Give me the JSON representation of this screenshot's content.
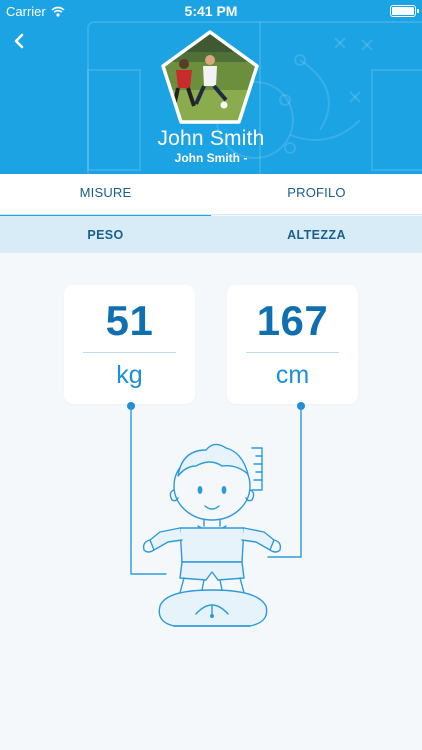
{
  "status_bar": {
    "carrier": "Carrier",
    "time": "5:41 PM",
    "icons": [
      "wifi-icon",
      "battery-icon"
    ]
  },
  "header": {
    "back_icon": "chevron-left-icon",
    "player_name": "John Smith",
    "player_subtitle": "John Smith -",
    "background_color": "#1ca3e4"
  },
  "tabs": [
    {
      "label": "MISURE",
      "active": true
    },
    {
      "label": "PROFILO",
      "active": false
    }
  ],
  "subtabs": [
    {
      "label": "PESO"
    },
    {
      "label": "ALTEZZA"
    }
  ],
  "measures": {
    "weight": {
      "value": "51",
      "unit": "kg"
    },
    "height": {
      "value": "167",
      "unit": "cm"
    }
  },
  "colors": {
    "accent": "#1ca3e4",
    "value_text": "#0f6fb1",
    "subtab_bg": "#d8ecf7",
    "page_bg": "#f4f8fa"
  }
}
